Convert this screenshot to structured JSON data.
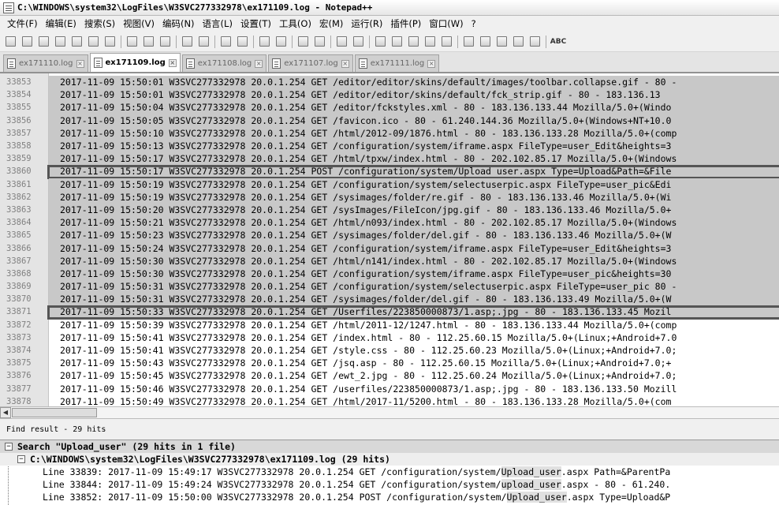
{
  "window": {
    "title": "C:\\WINDOWS\\system32\\LogFiles\\W3SVC277332978\\ex171109.log - Notepad++"
  },
  "menu": [
    "文件(F)",
    "编辑(E)",
    "搜索(S)",
    "视图(V)",
    "编码(N)",
    "语言(L)",
    "设置(T)",
    "工具(O)",
    "宏(M)",
    "运行(R)",
    "插件(P)",
    "窗口(W)",
    "?"
  ],
  "toolbar": {
    "spellcheck_label": "ABC"
  },
  "tabs": [
    {
      "label": "ex171110.log",
      "active": false
    },
    {
      "label": "ex171109.log",
      "active": true
    },
    {
      "label": "ex171108.log",
      "active": false
    },
    {
      "label": "ex171107.log",
      "active": false
    },
    {
      "label": "ex171111.log",
      "active": false
    }
  ],
  "editor": {
    "lines": [
      {
        "n": "33853",
        "text": "2017-11-09 15:50:01 W3SVC277332978 20.0.1.254 GET /editor/editor/skins/default/images/toolbar.collapse.gif - 80 -",
        "sel": true,
        "boxed": false
      },
      {
        "n": "33854",
        "text": "2017-11-09 15:50:01 W3SVC277332978 20.0.1.254 GET /editor/editor/skins/default/fck_strip.gif - 80 - 183.136.13",
        "sel": true,
        "boxed": false
      },
      {
        "n": "33855",
        "text": "2017-11-09 15:50:04 W3SVC277332978 20.0.1.254 GET /editor/fckstyles.xml - 80 - 183.136.133.44 Mozilla/5.0+(Windo",
        "sel": true,
        "boxed": false
      },
      {
        "n": "33856",
        "text": "2017-11-09 15:50:05 W3SVC277332978 20.0.1.254 GET /favicon.ico - 80 - 61.240.144.36 Mozilla/5.0+(Windows+NT+10.0",
        "sel": true,
        "boxed": false
      },
      {
        "n": "33857",
        "text": "2017-11-09 15:50:10 W3SVC277332978 20.0.1.254 GET /html/2012-09/1876.html - 80 - 183.136.133.28 Mozilla/5.0+(comp",
        "sel": true,
        "boxed": false
      },
      {
        "n": "33858",
        "text": "2017-11-09 15:50:13 W3SVC277332978 20.0.1.254 GET /configuration/system/iframe.aspx FileType=user_Edit&heights=3",
        "sel": true,
        "boxed": false
      },
      {
        "n": "33859",
        "text": "2017-11-09 15:50:17 W3SVC277332978 20.0.1.254 GET /html/tpxw/index.html - 80 - 202.102.85.17 Mozilla/5.0+(Windows",
        "sel": true,
        "boxed": false
      },
      {
        "n": "33860",
        "text": "2017-11-09 15:50:17 W3SVC277332978 20.0.1.254 POST /configuration/system/Upload user.aspx Type=Upload&Path=&File",
        "sel": true,
        "boxed": true
      },
      {
        "n": "33861",
        "text": "2017-11-09 15:50:19 W3SVC277332978 20.0.1.254 GET /configuration/system/selectuserpic.aspx FileType=user_pic&Edi",
        "sel": true,
        "boxed": false
      },
      {
        "n": "33862",
        "text": "2017-11-09 15:50:19 W3SVC277332978 20.0.1.254 GET /sysimages/folder/re.gif - 80 - 183.136.133.46 Mozilla/5.0+(Wi",
        "sel": true,
        "boxed": false
      },
      {
        "n": "33863",
        "text": "2017-11-09 15:50:20 W3SVC277332978 20.0.1.254 GET /sysImages/FileIcon/jpg.gif - 80 - 183.136.133.46 Mozilla/5.0+",
        "sel": true,
        "boxed": false
      },
      {
        "n": "33864",
        "text": "2017-11-09 15:50:21 W3SVC277332978 20.0.1.254 GET /html/n093/index.html - 80 - 202.102.85.17 Mozilla/5.0+(Windows",
        "sel": true,
        "boxed": false
      },
      {
        "n": "33865",
        "text": "2017-11-09 15:50:23 W3SVC277332978 20.0.1.254 GET /sysimages/folder/del.gif - 80 - 183.136.133.46 Mozilla/5.0+(W",
        "sel": true,
        "boxed": false
      },
      {
        "n": "33866",
        "text": "2017-11-09 15:50:24 W3SVC277332978 20.0.1.254 GET /configuration/system/iframe.aspx FileType=user_Edit&heights=3",
        "sel": true,
        "boxed": false
      },
      {
        "n": "33867",
        "text": "2017-11-09 15:50:30 W3SVC277332978 20.0.1.254 GET /html/n141/index.html - 80 - 202.102.85.17 Mozilla/5.0+(Windows",
        "sel": true,
        "boxed": false
      },
      {
        "n": "33868",
        "text": "2017-11-09 15:50:30 W3SVC277332978 20.0.1.254 GET /configuration/system/iframe.aspx FileType=user_pic&heights=30",
        "sel": true,
        "boxed": false
      },
      {
        "n": "33869",
        "text": "2017-11-09 15:50:31 W3SVC277332978 20.0.1.254 GET /configuration/system/selectuserpic.aspx FileType=user_pic 80 -",
        "sel": true,
        "boxed": false
      },
      {
        "n": "33870",
        "text": "2017-11-09 15:50:31 W3SVC277332978 20.0.1.254 GET /sysimages/folder/del.gif - 80 - 183.136.133.49 Mozilla/5.0+(W",
        "sel": true,
        "boxed": false
      },
      {
        "n": "33871",
        "text": "2017-11-09 15:50:33 W3SVC277332978 20.0.1.254 GET /Userfiles/223850000873/1.asp;.jpg - 80 - 183.136.133.45 Mozil",
        "sel": true,
        "boxed": true
      },
      {
        "n": "33872",
        "text": "2017-11-09 15:50:39 W3SVC277332978 20.0.1.254 GET /html/2011-12/1247.html - 80 - 183.136.133.44 Mozilla/5.0+(comp",
        "sel": false,
        "boxed": false
      },
      {
        "n": "33873",
        "text": "2017-11-09 15:50:41 W3SVC277332978 20.0.1.254 GET /index.html - 80 - 112.25.60.15 Mozilla/5.0+(Linux;+Android+7.0",
        "sel": false,
        "boxed": false
      },
      {
        "n": "33874",
        "text": "2017-11-09 15:50:41 W3SVC277332978 20.0.1.254 GET /style.css - 80 - 112.25.60.23 Mozilla/5.0+(Linux;+Android+7.0;",
        "sel": false,
        "boxed": false
      },
      {
        "n": "33875",
        "text": "2017-11-09 15:50:43 W3SVC277332978 20.0.1.254 GET /jsq.asp - 80 - 112.25.60.15 Mozilla/5.0+(Linux;+Android+7.0;+",
        "sel": false,
        "boxed": false
      },
      {
        "n": "33876",
        "text": "2017-11-09 15:50:45 W3SVC277332978 20.0.1.254 GET /ewt_2.jpg - 80 - 112.25.60.24 Mozilla/5.0+(Linux;+Android+7.0;",
        "sel": false,
        "boxed": false
      },
      {
        "n": "33877",
        "text": "2017-11-09 15:50:46 W3SVC277332978 20.0.1.254 GET /userfiles/223850000873/1.asp;.jpg - 80 - 183.136.133.50 Mozill",
        "sel": false,
        "boxed": false
      },
      {
        "n": "33878",
        "text": "2017-11-09 15:50:49 W3SVC277332978 20.0.1.254 GET /html/2017-11/5200.html - 80 - 183.136.133.28 Mozilla/5.0+(com",
        "sel": false,
        "boxed": false
      }
    ]
  },
  "find_result": {
    "header": "Find result - 29 hits",
    "search_line": "Search \"Upload_user\" (29 hits in 1 file)",
    "file_line": "C:\\WINDOWS\\system32\\LogFiles\\W3SVC277332978\\ex171109.log (29 hits)",
    "hits": [
      {
        "pre": "Line 33839: 2017-11-09 15:49:17 W3SVC277332978 20.0.1.254 GET /configuration/system/",
        "match": "Upload_user",
        "post": ".aspx Path=&ParentPa"
      },
      {
        "pre": "Line 33844: 2017-11-09 15:49:24 W3SVC277332978 20.0.1.254 GET /configuration/system/",
        "match": "upload_user",
        "post": ".aspx - 80 - 61.240."
      },
      {
        "pre": "Line 33852: 2017-11-09 15:50:00 W3SVC277332978 20.0.1.254 POST /configuration/system/",
        "match": "Upload_user",
        "post": ".aspx Type=Upload&P"
      }
    ]
  },
  "colors": {
    "selection": "#c8c8c8",
    "gutter": "#e4e4e4",
    "box_border": "#555555"
  }
}
